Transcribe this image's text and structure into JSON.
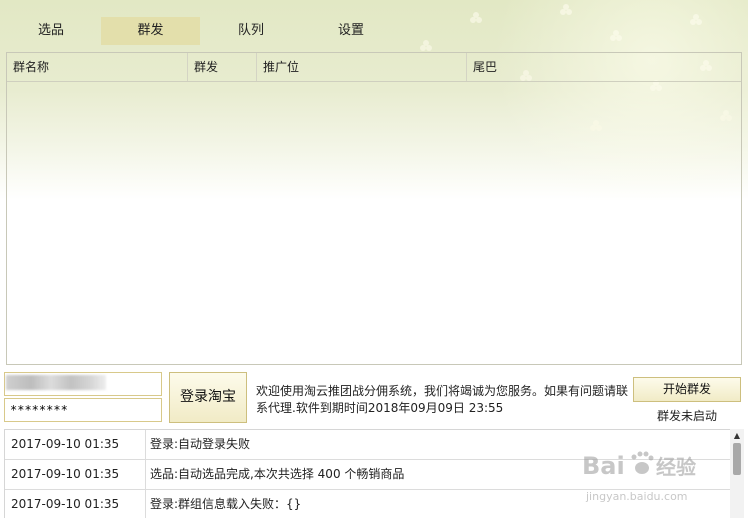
{
  "tabs": [
    {
      "label": "选品",
      "active": false
    },
    {
      "label": "群发",
      "active": true
    },
    {
      "label": "队列",
      "active": false
    },
    {
      "label": "设置",
      "active": false
    }
  ],
  "grid": {
    "columns": [
      "群名称",
      "群发",
      "推广位",
      "尾巴"
    ]
  },
  "login": {
    "username_value": "",
    "password_value": "********",
    "login_button": "登录淘宝"
  },
  "welcome_message": "欢迎使用淘云推团战分佣系统，我们将竭诚为您服务。如果有问题请联系代理.软件到期时间2018年09月09日 23:55",
  "broadcast": {
    "start_button": "开始群发",
    "status": "群发未启动"
  },
  "log": [
    {
      "time": "2017-09-10 01:35",
      "message": "登录:自动登录失败"
    },
    {
      "time": "2017-09-10 01:35",
      "message": "选品:自动选品完成,本次共选择 400 个畅销商品"
    },
    {
      "time": "2017-09-10 01:35",
      "message": "登录:群组信息载入失败：{}"
    }
  ],
  "watermark": {
    "brand": "Bai",
    "brand_cn": "经验",
    "url": "jingyan.baidu.com"
  },
  "colors": {
    "accent": "#e3dfab",
    "button_border": "#cdbf7e",
    "header_bg": "#e2e8c4"
  }
}
